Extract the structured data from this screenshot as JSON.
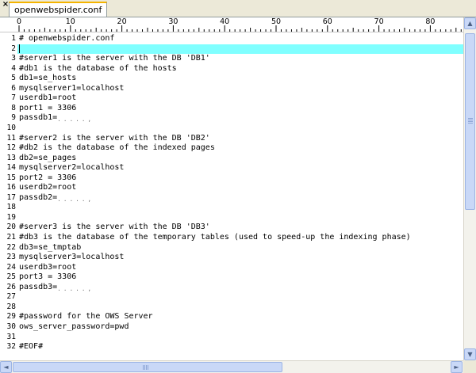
{
  "window": {
    "close_glyph": "×"
  },
  "tab": {
    "label": "openwebspider.conf"
  },
  "ruler": {
    "labels": [
      "0",
      "10",
      "20",
      "30",
      "40",
      "50",
      "60",
      "70",
      "80"
    ]
  },
  "editor": {
    "current_line": 2,
    "lines": [
      {
        "num": "1",
        "text": "# openwebspider.conf"
      },
      {
        "num": "2",
        "text": ""
      },
      {
        "num": "3",
        "text": "#server1 is the server with the DB 'DB1'"
      },
      {
        "num": "4",
        "text": "#db1 is the database of the hosts"
      },
      {
        "num": "5",
        "text": "db1=se_hosts"
      },
      {
        "num": "6",
        "text": "mysqlserver1=localhost"
      },
      {
        "num": "7",
        "text": "userdb1=root"
      },
      {
        "num": "8",
        "text": "port1 = 3306"
      },
      {
        "num": "9",
        "text": "passdb1="
      },
      {
        "num": "10",
        "text": ""
      },
      {
        "num": "11",
        "text": "#server2 is the server with the DB 'DB2'"
      },
      {
        "num": "12",
        "text": "#db2 is the database of the indexed pages"
      },
      {
        "num": "13",
        "text": "db2=se_pages"
      },
      {
        "num": "14",
        "text": "mysqlserver2=localhost"
      },
      {
        "num": "15",
        "text": "port2 = 3306"
      },
      {
        "num": "16",
        "text": "userdb2=root"
      },
      {
        "num": "17",
        "text": "passdb2="
      },
      {
        "num": "18",
        "text": ""
      },
      {
        "num": "19",
        "text": ""
      },
      {
        "num": "20",
        "text": "#server3 is the server with the DB 'DB3'"
      },
      {
        "num": "21",
        "text": "#db3 is the database of the temporary tables (used to speed-up the indexing phase)"
      },
      {
        "num": "22",
        "text": "db3=se_tmptab"
      },
      {
        "num": "23",
        "text": "mysqlserver3=localhost"
      },
      {
        "num": "24",
        "text": "userdb3=root"
      },
      {
        "num": "25",
        "text": "port3 = 3306"
      },
      {
        "num": "26",
        "text": "passdb3="
      },
      {
        "num": "27",
        "text": ""
      },
      {
        "num": "28",
        "text": ""
      },
      {
        "num": "29",
        "text": "#password for the OWS Server"
      },
      {
        "num": "30",
        "text": "ows_server_password=pwd"
      },
      {
        "num": "31",
        "text": ""
      },
      {
        "num": "32",
        "text": "#EOF#"
      }
    ],
    "redacted_lines": [
      9,
      17,
      26
    ]
  },
  "scrollbars": {
    "up_glyph": "▲",
    "down_glyph": "▼",
    "left_glyph": "◄",
    "right_glyph": "►"
  },
  "colors": {
    "current_line_highlight": "#80ffff",
    "tab_accent": "#f4b400"
  }
}
